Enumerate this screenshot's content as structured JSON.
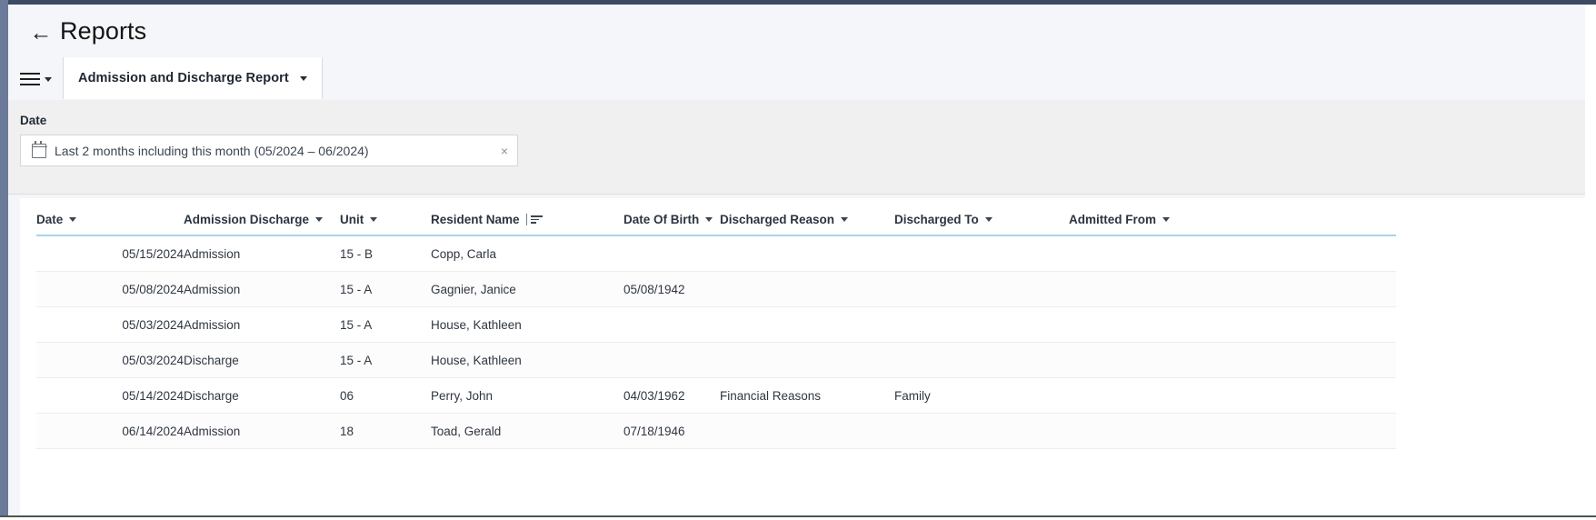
{
  "header": {
    "back_icon": "back-arrow-icon",
    "title": "Reports"
  },
  "toolbar": {
    "menu_icon": "hamburger-menu-icon",
    "menu_caret_icon": "chevron-down-icon",
    "tab_label": "Admission and Discharge Report",
    "tab_caret_icon": "chevron-down-icon"
  },
  "filter": {
    "label": "Date",
    "calendar_icon": "calendar-icon",
    "value": "Last 2 months including this month (05/2024 – 06/2024)",
    "clear_icon": "×"
  },
  "table": {
    "columns": [
      {
        "label": "Date",
        "sort_icon": "chevron-down-icon"
      },
      {
        "label": "Admission Discharge",
        "sort_icon": "chevron-down-icon"
      },
      {
        "label": "Unit",
        "sort_icon": "chevron-down-icon"
      },
      {
        "label": "Resident Name",
        "sort_icon": "sort-ascending-icon"
      },
      {
        "label": "Date Of Birth",
        "sort_icon": "chevron-down-icon"
      },
      {
        "label": "Discharged Reason",
        "sort_icon": "chevron-down-icon"
      },
      {
        "label": "Discharged To",
        "sort_icon": "chevron-down-icon"
      },
      {
        "label": "Admitted From",
        "sort_icon": "chevron-down-icon"
      }
    ],
    "rows": [
      {
        "date": "05/15/2024",
        "admission_discharge": "Admission",
        "unit": "15 - B",
        "resident_name": "Copp, Carla",
        "date_of_birth": "",
        "discharged_reason": "",
        "discharged_to": "",
        "admitted_from": ""
      },
      {
        "date": "05/08/2024",
        "admission_discharge": "Admission",
        "unit": "15 - A",
        "resident_name": "Gagnier, Janice",
        "date_of_birth": "05/08/1942",
        "discharged_reason": "",
        "discharged_to": "",
        "admitted_from": ""
      },
      {
        "date": "05/03/2024",
        "admission_discharge": "Admission",
        "unit": "15 - A",
        "resident_name": "House, Kathleen",
        "date_of_birth": "",
        "discharged_reason": "",
        "discharged_to": "",
        "admitted_from": ""
      },
      {
        "date": "05/03/2024",
        "admission_discharge": "Discharge",
        "unit": "15 - A",
        "resident_name": "House, Kathleen",
        "date_of_birth": "",
        "discharged_reason": "",
        "discharged_to": "",
        "admitted_from": ""
      },
      {
        "date": "05/14/2024",
        "admission_discharge": "Discharge",
        "unit": "06",
        "resident_name": "Perry, John",
        "date_of_birth": "04/03/1962",
        "discharged_reason": "Financial Reasons",
        "discharged_to": "Family",
        "admitted_from": ""
      },
      {
        "date": "06/14/2024",
        "admission_discharge": "Admission",
        "unit": "18",
        "resident_name": "Toad, Gerald",
        "date_of_birth": "07/18/1946",
        "discharged_reason": "",
        "discharged_to": "",
        "admitted_from": ""
      }
    ]
  },
  "colors": {
    "frame_left": "#6b7a99",
    "frame_top": "#3c4a63",
    "page_background": "#f4f6f9",
    "filter_background": "#f0f0f0",
    "card_background": "#ffffff",
    "header_underline": "#a8d3e8",
    "row_divider": "#ededed",
    "text_primary": "#2b3440"
  }
}
